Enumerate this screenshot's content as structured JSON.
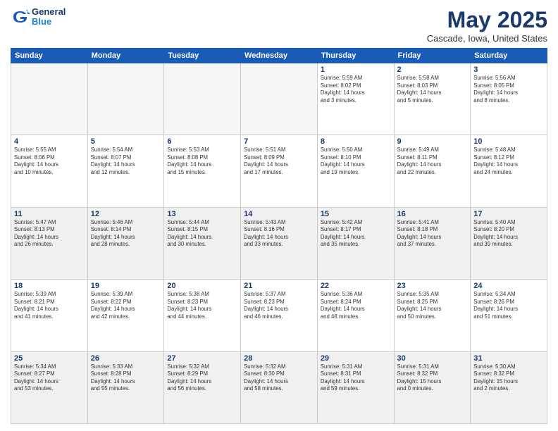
{
  "header": {
    "logo_line1": "General",
    "logo_line2": "Blue",
    "month": "May 2025",
    "location": "Cascade, Iowa, United States"
  },
  "weekdays": [
    "Sunday",
    "Monday",
    "Tuesday",
    "Wednesday",
    "Thursday",
    "Friday",
    "Saturday"
  ],
  "rows": [
    [
      {
        "day": "",
        "empty": true
      },
      {
        "day": "",
        "empty": true
      },
      {
        "day": "",
        "empty": true
      },
      {
        "day": "",
        "empty": true
      },
      {
        "day": "1",
        "info": "Sunrise: 5:59 AM\nSunset: 8:02 PM\nDaylight: 14 hours\nand 3 minutes."
      },
      {
        "day": "2",
        "info": "Sunrise: 5:58 AM\nSunset: 8:03 PM\nDaylight: 14 hours\nand 5 minutes."
      },
      {
        "day": "3",
        "info": "Sunrise: 5:56 AM\nSunset: 8:05 PM\nDaylight: 14 hours\nand 8 minutes."
      }
    ],
    [
      {
        "day": "4",
        "info": "Sunrise: 5:55 AM\nSunset: 8:06 PM\nDaylight: 14 hours\nand 10 minutes."
      },
      {
        "day": "5",
        "info": "Sunrise: 5:54 AM\nSunset: 8:07 PM\nDaylight: 14 hours\nand 12 minutes."
      },
      {
        "day": "6",
        "info": "Sunrise: 5:53 AM\nSunset: 8:08 PM\nDaylight: 14 hours\nand 15 minutes."
      },
      {
        "day": "7",
        "info": "Sunrise: 5:51 AM\nSunset: 8:09 PM\nDaylight: 14 hours\nand 17 minutes."
      },
      {
        "day": "8",
        "info": "Sunrise: 5:50 AM\nSunset: 8:10 PM\nDaylight: 14 hours\nand 19 minutes."
      },
      {
        "day": "9",
        "info": "Sunrise: 5:49 AM\nSunset: 8:11 PM\nDaylight: 14 hours\nand 22 minutes."
      },
      {
        "day": "10",
        "info": "Sunrise: 5:48 AM\nSunset: 8:12 PM\nDaylight: 14 hours\nand 24 minutes."
      }
    ],
    [
      {
        "day": "11",
        "info": "Sunrise: 5:47 AM\nSunset: 8:13 PM\nDaylight: 14 hours\nand 26 minutes."
      },
      {
        "day": "12",
        "info": "Sunrise: 5:46 AM\nSunset: 8:14 PM\nDaylight: 14 hours\nand 28 minutes."
      },
      {
        "day": "13",
        "info": "Sunrise: 5:44 AM\nSunset: 8:15 PM\nDaylight: 14 hours\nand 30 minutes."
      },
      {
        "day": "14",
        "info": "Sunrise: 5:43 AM\nSunset: 8:16 PM\nDaylight: 14 hours\nand 33 minutes."
      },
      {
        "day": "15",
        "info": "Sunrise: 5:42 AM\nSunset: 8:17 PM\nDaylight: 14 hours\nand 35 minutes."
      },
      {
        "day": "16",
        "info": "Sunrise: 5:41 AM\nSunset: 8:18 PM\nDaylight: 14 hours\nand 37 minutes."
      },
      {
        "day": "17",
        "info": "Sunrise: 5:40 AM\nSunset: 8:20 PM\nDaylight: 14 hours\nand 39 minutes."
      }
    ],
    [
      {
        "day": "18",
        "info": "Sunrise: 5:39 AM\nSunset: 8:21 PM\nDaylight: 14 hours\nand 41 minutes."
      },
      {
        "day": "19",
        "info": "Sunrise: 5:39 AM\nSunset: 8:22 PM\nDaylight: 14 hours\nand 42 minutes."
      },
      {
        "day": "20",
        "info": "Sunrise: 5:38 AM\nSunset: 8:23 PM\nDaylight: 14 hours\nand 44 minutes."
      },
      {
        "day": "21",
        "info": "Sunrise: 5:37 AM\nSunset: 8:23 PM\nDaylight: 14 hours\nand 46 minutes."
      },
      {
        "day": "22",
        "info": "Sunrise: 5:36 AM\nSunset: 8:24 PM\nDaylight: 14 hours\nand 48 minutes."
      },
      {
        "day": "23",
        "info": "Sunrise: 5:35 AM\nSunset: 8:25 PM\nDaylight: 14 hours\nand 50 minutes."
      },
      {
        "day": "24",
        "info": "Sunrise: 5:34 AM\nSunset: 8:26 PM\nDaylight: 14 hours\nand 51 minutes."
      }
    ],
    [
      {
        "day": "25",
        "info": "Sunrise: 5:34 AM\nSunset: 8:27 PM\nDaylight: 14 hours\nand 53 minutes."
      },
      {
        "day": "26",
        "info": "Sunrise: 5:33 AM\nSunset: 8:28 PM\nDaylight: 14 hours\nand 55 minutes."
      },
      {
        "day": "27",
        "info": "Sunrise: 5:32 AM\nSunset: 8:29 PM\nDaylight: 14 hours\nand 56 minutes."
      },
      {
        "day": "28",
        "info": "Sunrise: 5:32 AM\nSunset: 8:30 PM\nDaylight: 14 hours\nand 58 minutes."
      },
      {
        "day": "29",
        "info": "Sunrise: 5:31 AM\nSunset: 8:31 PM\nDaylight: 14 hours\nand 59 minutes."
      },
      {
        "day": "30",
        "info": "Sunrise: 5:31 AM\nSunset: 8:32 PM\nDaylight: 15 hours\nand 0 minutes."
      },
      {
        "day": "31",
        "info": "Sunrise: 5:30 AM\nSunset: 8:32 PM\nDaylight: 15 hours\nand 2 minutes."
      }
    ]
  ]
}
